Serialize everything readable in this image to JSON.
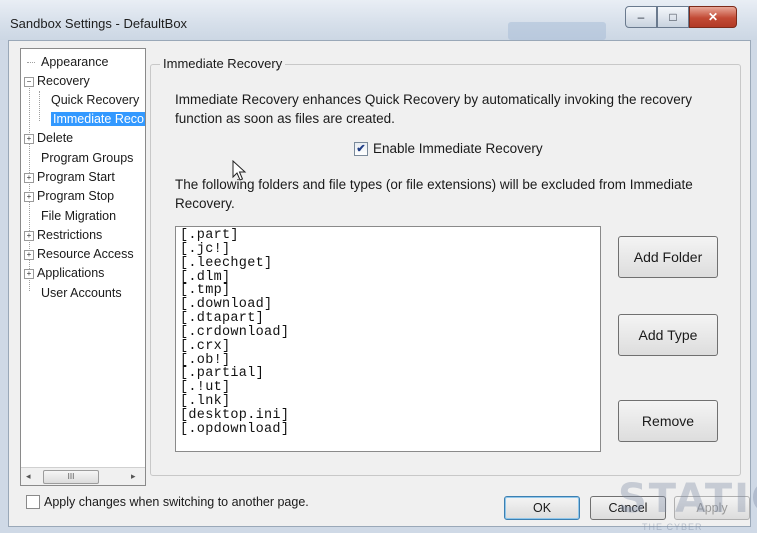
{
  "window": {
    "title": "Sandbox Settings - DefaultBox",
    "minimize_glyph": "‒",
    "maximize_glyph": "□",
    "close_glyph": "✕"
  },
  "tree": {
    "items": [
      {
        "label": "Appearance"
      },
      {
        "label": "Recovery",
        "expander": "−"
      },
      {
        "label": "Quick Recovery"
      },
      {
        "label": "Immediate Reco",
        "selected": true
      },
      {
        "label": "Delete",
        "expander": "+"
      },
      {
        "label": "Program Groups"
      },
      {
        "label": "Program Start",
        "expander": "+"
      },
      {
        "label": "Program Stop",
        "expander": "+"
      },
      {
        "label": "File Migration"
      },
      {
        "label": "Restrictions",
        "expander": "+"
      },
      {
        "label": "Resource Access",
        "expander": "+"
      },
      {
        "label": "Applications",
        "expander": "+"
      },
      {
        "label": "User Accounts"
      }
    ],
    "scroll_left": "◂",
    "scroll_right": "▸",
    "scroll_thumb": "III"
  },
  "panel": {
    "group_title": "Immediate Recovery",
    "description": "Immediate Recovery enhances Quick Recovery by automatically invoking the recovery function as soon as files are created.",
    "enable_label": "Enable Immediate Recovery",
    "enable_checked": true,
    "check_glyph": "✔",
    "exclusion_text": "The following folders and file types (or file extensions) will be excluded from Immediate Recovery.",
    "exclusions": [
      "[.part]",
      "[.jc!]",
      "[.leechget]",
      "[.dlm]",
      "[.tmp]",
      "[.download]",
      "[.dtapart]",
      "[.crdownload]",
      "[.crx]",
      "[.ob!]",
      "[.partial]",
      "[.!ut]",
      "[.lnk]",
      "[desktop.ini]",
      "[.opdownload]"
    ],
    "add_folder_label": "Add Folder",
    "add_type_label": "Add Type",
    "remove_label": "Remove"
  },
  "footer": {
    "apply_on_switch_label": "Apply changes when switching to another page.",
    "ok_label": "OK",
    "cancel_label": "Cancel",
    "apply_label": "Apply"
  },
  "watermark": {
    "text": "STATIC",
    "sub": "THE CYBER SECURITY"
  }
}
